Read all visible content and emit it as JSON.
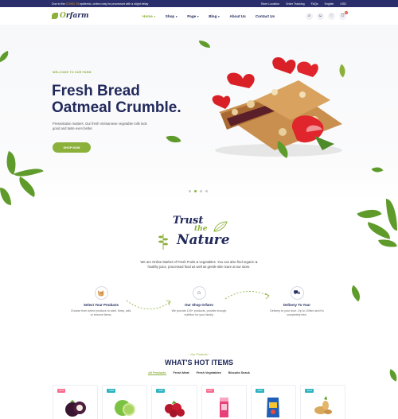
{
  "topbar": {
    "notice_prefix": "Due to the",
    "notice_highlight": "COVID 19",
    "notice_suffix": "epidemic, orders may be processed with a slight delay",
    "links": [
      "Store Location",
      "Order Tracking",
      "FAQs",
      "English",
      "USD"
    ]
  },
  "header": {
    "logo_text_a": "O",
    "logo_text_b": "rfarm",
    "nav": [
      "Home",
      "Shop",
      "Page",
      "Blog",
      "About Us",
      "Contact Us"
    ],
    "cart_count": "0",
    "colors": {
      "accent": "#8cb13a",
      "navy": "#222a5c",
      "topbar": "#2a2f6c"
    }
  },
  "hero": {
    "eyebrow": "WELCOME TO OUR FARM",
    "title": "Fresh Bread Oatmeal Crumble.",
    "description": "Presentation matters. Our fresh Vietnamese vegetable rolls look good and taste even better.",
    "cta": "SHOP NOW",
    "slides": 4,
    "active_slide": 2
  },
  "trust": {
    "line1": "Trust",
    "line2": "the",
    "line3": "Nature",
    "about": "We are Online Market of Fresh Fruits & vegetables. You can also find organic & healthy juice, processed food as well as gentle skin tcare at our store."
  },
  "steps": [
    {
      "icon": "basket-icon",
      "title": "Select Your Products",
      "desc": "Choose from select produce to start. Keep, add, or remove items."
    },
    {
      "icon": "store-icon",
      "title": "Our Shop Orfarm",
      "desc": "We provide 100+ products, provide enough nutrition for your family."
    },
    {
      "icon": "truck-icon",
      "title": "Delivery To Your",
      "desc": "Delivery to your door. Up to 100km and it's completely free."
    }
  ],
  "hot_items": {
    "eyebrow": "~ Our Products ~",
    "title": "WHAT'S HOT ITEMS",
    "tabs": [
      "All Products",
      "Fresh Meat",
      "Fresh Vegetables",
      "Biscuits Snack"
    ],
    "products": [
      {
        "tag": "HOT",
        "tag_color": "#f66b8e",
        "image": "mangosteen-icon"
      },
      {
        "tag": "-10%",
        "tag_color": "#2bb3c0",
        "image": "lime-icon"
      },
      {
        "tag": "-20%",
        "tag_color": "#2bb3c0",
        "image": "cranberry-icon"
      },
      {
        "tag": "HOT",
        "tag_color": "#f66b8e",
        "image": "juice-box-icon"
      },
      {
        "tag": "-10%",
        "tag_color": "#2bb3c0",
        "image": "snack-bag-icon"
      },
      {
        "tag": "-10%",
        "tag_color": "#2bb3c0",
        "image": "ginger-icon"
      }
    ]
  }
}
